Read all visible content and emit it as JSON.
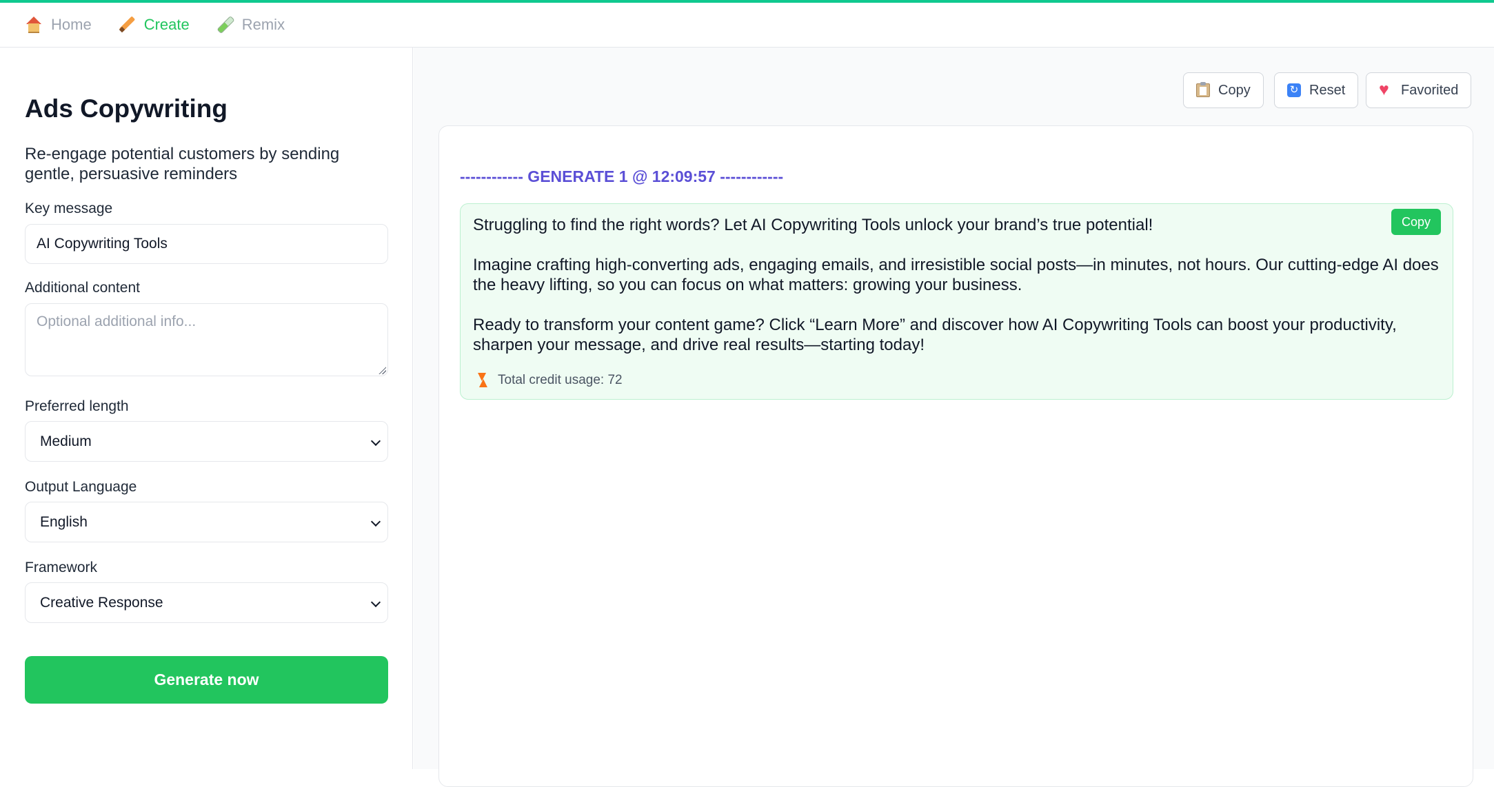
{
  "nav": {
    "items": [
      {
        "label": "Home",
        "icon": "house-icon"
      },
      {
        "label": "Create",
        "icon": "pencil-icon",
        "active": true
      },
      {
        "label": "Remix",
        "icon": "test-tube-icon"
      }
    ]
  },
  "form": {
    "title": "Ads Copywriting",
    "subtitle": "Re-engage potential customers by sending gentle, persuasive reminders",
    "key_message": {
      "label": "Key message",
      "value": "AI Copywriting Tools"
    },
    "additional_content": {
      "label": "Additional content",
      "placeholder": "Optional additional info..."
    },
    "preferred_length": {
      "label": "Preferred length",
      "value": "Medium"
    },
    "output_language": {
      "label": "Output Language",
      "value": "English"
    },
    "framework": {
      "label": "Framework",
      "value": "Creative Response"
    },
    "generate_label": "Generate now"
  },
  "toolbar": {
    "copy_label": "Copy",
    "reset_label": "Reset",
    "favorited_label": "Favorited"
  },
  "output": {
    "header": "------------ GENERATE 1 @ 12:09:57 ------------",
    "copy_label": "Copy",
    "paragraphs": [
      "Struggling to find the right words? Let AI Copywriting Tools unlock your brand’s true potential!",
      "Imagine crafting high-converting ads, engaging emails, and irresistible social posts—in minutes, not hours. Our cutting-edge AI does the heavy lifting, so you can focus on what matters: growing your business.",
      "Ready to transform your content game? Click “Learn More” and discover how AI Copywriting Tools can boost your productivity, sharpen your message, and drive real results—starting today!"
    ],
    "credit_usage": "Total credit usage: 72"
  },
  "colors": {
    "accent_green": "#22c55e",
    "top_border": "#10c98f",
    "header_purple": "#5b4fd6",
    "result_bg": "#effcf3"
  }
}
